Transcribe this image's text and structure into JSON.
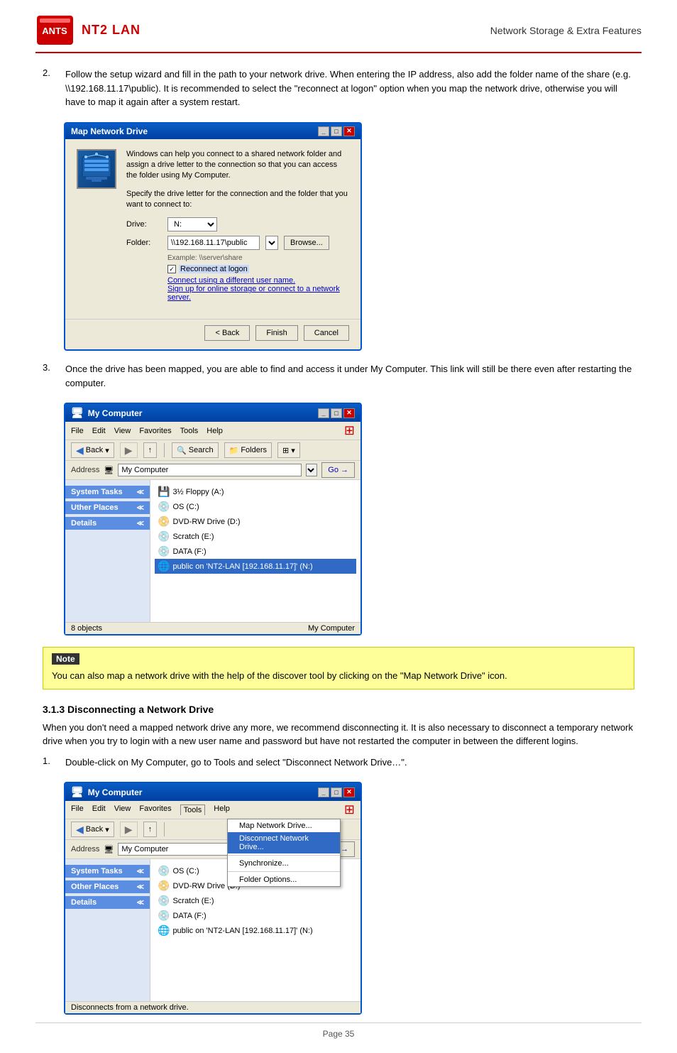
{
  "header": {
    "title": "NT2 LAN",
    "subtitle": "Network Storage & Extra Features",
    "logo_text": "ANTS"
  },
  "step2": {
    "text": "Follow the setup wizard and fill in the path to your network drive. When entering the IP address, also add the folder name of the share (e.g. \\\\192.168.11.17\\public). It is recommended to select the \"reconnect at logon\" option when you map the network drive, otherwise you will have to map it again after a system restart."
  },
  "map_dialog": {
    "title": "Map Network Drive",
    "desc1": "Windows can help you connect to a shared network folder and assign a drive letter to the connection so that you can access the folder using My Computer.",
    "desc2": "Specify the drive letter for the connection and the folder that you want to connect to:",
    "drive_label": "Drive:",
    "drive_value": "N:",
    "folder_label": "Folder:",
    "folder_value": "\\\\192.168.11.17\\public",
    "browse_label": "Browse...",
    "example_text": "Example: \\\\server\\share",
    "reconnect_label": "Reconnect at logon",
    "link1": "Connect using a different user name.",
    "link2": "Sign up for online storage or connect to a network server.",
    "btn_back": "< Back",
    "btn_finish": "Finish",
    "btn_cancel": "Cancel"
  },
  "step3": {
    "text": "Once the drive has been mapped, you are able to find and access it under My Computer. This link will still be there even after restarting the computer."
  },
  "mycomp1": {
    "title": "My Computer",
    "menus": [
      "File",
      "Edit",
      "View",
      "Favorites",
      "Tools",
      "Help"
    ],
    "toolbar": {
      "back": "Back",
      "search": "Search",
      "folders": "Folders"
    },
    "address_label": "Address",
    "address_value": "My Computer",
    "sidebar": {
      "system_tasks": "System Tasks",
      "other_places": "Other Places",
      "details": "Details"
    },
    "drives": [
      {
        "icon": "💾",
        "label": "3½ Floppy (A:)"
      },
      {
        "icon": "💿",
        "label": "OS (C:)"
      },
      {
        "icon": "📀",
        "label": "DVD-RW Drive (D:)"
      },
      {
        "icon": "💿",
        "label": "Scratch (E:)"
      },
      {
        "icon": "💿",
        "label": "DATA (F:)"
      },
      {
        "icon": "🌐",
        "label": "public on 'NT2-LAN [192.168.11.17]' (N:)",
        "selected": true
      }
    ],
    "status": "8 objects",
    "status_right": "My Computer"
  },
  "note": {
    "label": "Note",
    "text": "You can also map a network drive with the help of the discover tool by clicking on the \"Map Network Drive\" icon."
  },
  "section313": {
    "heading": "3.1.3    Disconnecting a Network Drive",
    "body": "When you don't need a mapped network drive any more, we recommend disconnecting it. It is also necessary to disconnect a temporary network drive when you try to login with a new user name and password but have not restarted the computer in between the different logins."
  },
  "step_dc1": {
    "text": "Double-click on My Computer, go to Tools and select \"Disconnect Network Drive…\"."
  },
  "mycomp2": {
    "title": "My Computer",
    "menus": [
      "File",
      "Edit",
      "View",
      "Favorites",
      "Tools",
      "Help"
    ],
    "tools_menu": {
      "items": [
        {
          "label": "Map Network Drive...",
          "highlighted": false
        },
        {
          "label": "Disconnect Network Drive...",
          "highlighted": true
        },
        {
          "label": "Synchronize...",
          "highlighted": false
        },
        {
          "label": "Folder Options...",
          "highlighted": false
        }
      ]
    },
    "address_label": "Address",
    "address_value": "My Computer",
    "sidebar": {
      "system_tasks": "System Tasks",
      "other_places": "Other Places",
      "details": "Details"
    },
    "drives": [
      {
        "icon": "💿",
        "label": "OS (C:)"
      },
      {
        "icon": "📀",
        "label": "DVD-RW Drive (D:)"
      },
      {
        "icon": "💿",
        "label": "Scratch (E:)"
      },
      {
        "icon": "💿",
        "label": "DATA (F:)"
      },
      {
        "icon": "🌐",
        "label": "public on 'NT2-LAN [192.168.11.17]' (N:)"
      }
    ],
    "status": "Disconnects from a network drive."
  },
  "footer": {
    "page": "Page 35"
  },
  "other_places_label": "Uther Places"
}
